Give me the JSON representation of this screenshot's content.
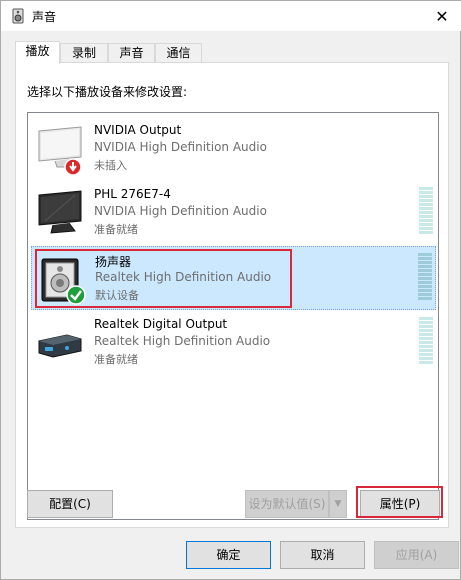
{
  "window": {
    "title": "声音",
    "close_glyph": "✕"
  },
  "tabs": [
    {
      "label": "播放",
      "active": true
    },
    {
      "label": "录制",
      "active": false
    },
    {
      "label": "声音",
      "active": false
    },
    {
      "label": "通信",
      "active": false
    }
  ],
  "panel": {
    "instruction": "选择以下播放设备来修改设置:"
  },
  "devices": [
    {
      "name": "NVIDIA Output",
      "desc": "NVIDIA High Definition Audio",
      "status": "未插入",
      "icon": "monitor-unplugged-icon",
      "selected": false,
      "meter": false
    },
    {
      "name": "PHL 276E7-4",
      "desc": "NVIDIA High Definition Audio",
      "status": "准备就绪",
      "icon": "monitor-icon",
      "selected": false,
      "meter": true
    },
    {
      "name": "扬声器",
      "desc": "Realtek High Definition Audio",
      "status": "默认设备",
      "icon": "speaker-default-icon",
      "selected": true,
      "meter": true
    },
    {
      "name": "Realtek Digital Output",
      "desc": "Realtek High Definition Audio",
      "status": "准备就绪",
      "icon": "digital-output-icon",
      "selected": false,
      "meter": true
    }
  ],
  "buttons": {
    "configure": "配置(C)",
    "set_default": "设为默认值(S)",
    "set_default_arrow": "▼",
    "properties": "属性(P)",
    "ok": "确定",
    "cancel": "取消",
    "apply": "应用(A)"
  },
  "colors": {
    "highlight": "#d9283a",
    "selected_bg": "#cce8ff",
    "default_check": "#1e9e3c",
    "unplugged_badge": "#d92a2a"
  }
}
